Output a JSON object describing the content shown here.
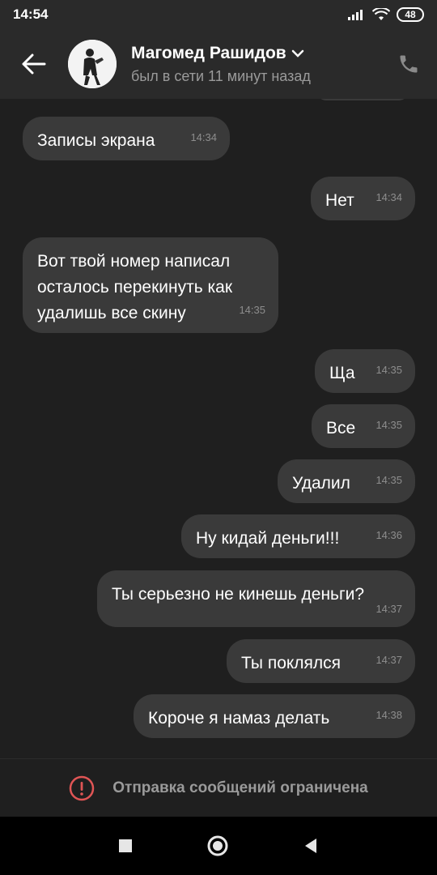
{
  "status_bar": {
    "time": "14:54",
    "battery": "48"
  },
  "header": {
    "contact_name": "Магомед Рашидов",
    "contact_status": "был в сети 11 минут назад"
  },
  "messages": [
    {
      "text": "Записы экрана",
      "time": "14:34",
      "side": "left"
    },
    {
      "text": "Нет",
      "time": "14:34",
      "side": "right"
    },
    {
      "text": "Вот твой номер написал осталось перекинуть как удалишь все скину",
      "time": "14:35",
      "side": "left"
    },
    {
      "text": "Ща",
      "time": "14:35",
      "side": "right"
    },
    {
      "text": "Все",
      "time": "14:35",
      "side": "right"
    },
    {
      "text": "Удалил",
      "time": "14:35",
      "side": "right"
    },
    {
      "text": "Ну кидай деньги!!!",
      "time": "14:36",
      "side": "right"
    },
    {
      "text": "Ты серьезно не кинешь деньги?",
      "time": "14:37",
      "side": "right"
    },
    {
      "text": "Ты поклялся",
      "time": "14:37",
      "side": "right"
    },
    {
      "text": "Короче я намаз делать",
      "time": "14:38",
      "side": "right"
    }
  ],
  "restricted": {
    "text": "Отправка сообщений ограничена"
  },
  "colors": {
    "accent_warning": "#e05555",
    "bubble": "#3a3a3a",
    "background": "#1f1f1f"
  }
}
